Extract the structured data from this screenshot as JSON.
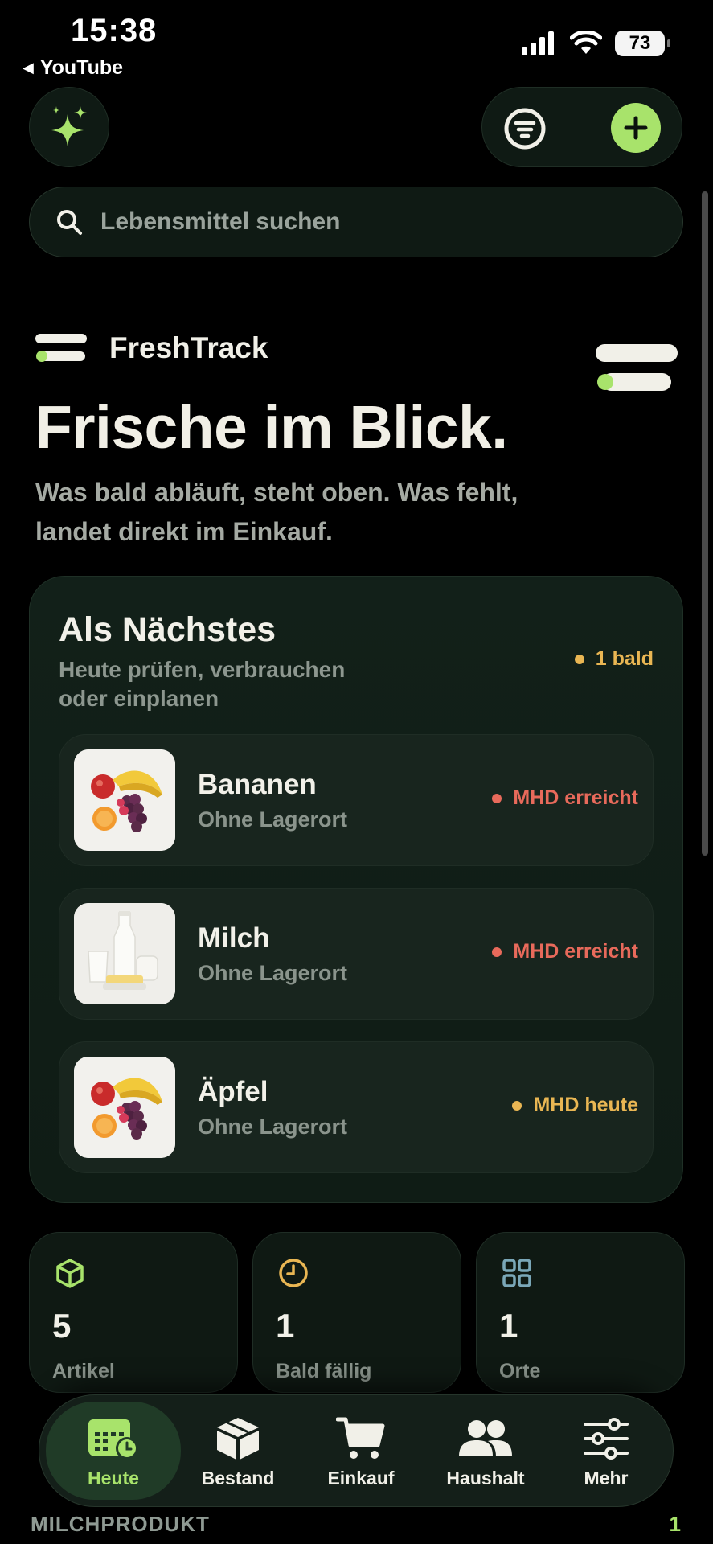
{
  "status_bar": {
    "time": "15:38",
    "back_app": "YouTube",
    "battery": "73"
  },
  "search": {
    "placeholder": "Lebensmittel suchen"
  },
  "hero": {
    "brand": "FreshTrack",
    "title": "Frische im Blick.",
    "subtitle": "Was bald abläuft, steht oben. Was fehlt, landet direkt im Einkauf."
  },
  "next_card": {
    "title": "Als Nächstes",
    "subtitle": "Heute prüfen, verbrauchen oder einplanen",
    "badge": "1 bald",
    "items": [
      {
        "name": "Bananen",
        "location": "Ohne Lagerort",
        "status": "MHD erreicht",
        "status_color": "#e86a5b",
        "image": "fruit-bowl-image"
      },
      {
        "name": "Milch",
        "location": "Ohne Lagerort",
        "status": "MHD erreicht",
        "status_color": "#e86a5b",
        "image": "dairy-image"
      },
      {
        "name": "Äpfel",
        "location": "Ohne Lagerort",
        "status": "MHD heute",
        "status_color": "#e9b653",
        "image": "fruit-bowl-image"
      }
    ]
  },
  "stats": [
    {
      "value": "5",
      "label": "Artikel",
      "icon": "cube-icon",
      "color": "#a8e36b"
    },
    {
      "value": "1",
      "label": "Bald fällig",
      "icon": "clock-icon",
      "color": "#e9b653"
    },
    {
      "value": "1",
      "label": "Orte",
      "icon": "grid-icon",
      "color": "#7aa7b8"
    }
  ],
  "tabs": [
    {
      "label": "Heute",
      "icon": "calendar-icon",
      "active": true
    },
    {
      "label": "Bestand",
      "icon": "box-icon",
      "active": false
    },
    {
      "label": "Einkauf",
      "icon": "cart-icon",
      "active": false
    },
    {
      "label": "Haushalt",
      "icon": "people-icon",
      "active": false
    },
    {
      "label": "Mehr",
      "icon": "sliders-icon",
      "active": false
    }
  ],
  "peek": {
    "section": "MILCHPRODUKT",
    "count": "1"
  },
  "colors": {
    "accent": "#a8e36b",
    "warning": "#e9b653",
    "danger": "#e86a5b",
    "background": "#000000"
  }
}
